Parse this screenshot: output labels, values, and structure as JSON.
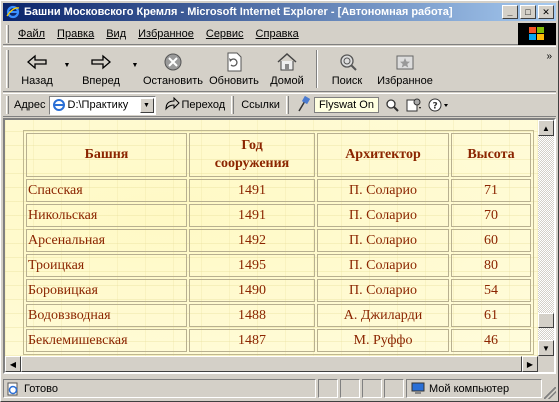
{
  "window": {
    "title": "Башни Московского Кремля - Microsoft Internet Explorer - [Автономная работа]",
    "buttons": [
      "minimize",
      "maximize",
      "close"
    ]
  },
  "menu": [
    {
      "label": "Файл"
    },
    {
      "label": "Правка"
    },
    {
      "label": "Вид"
    },
    {
      "label": "Избранное"
    },
    {
      "label": "Сервис"
    },
    {
      "label": "Справка"
    }
  ],
  "toolbar": {
    "back": "Назад",
    "forward": "Вперед",
    "stop": "Остановить",
    "refresh": "Обновить",
    "home": "Домой",
    "search": "Поиск",
    "favorites": "Избранное"
  },
  "addressbar": {
    "label": "Адрес",
    "value": "D:\\Практику",
    "go": "Переход",
    "links": "Ссылки",
    "flyswat": "Flyswat  On"
  },
  "table": {
    "headers": [
      "Башня",
      "Год сооружения",
      "Архитектор",
      "Высота"
    ],
    "rows": [
      [
        "Спасская",
        "1491",
        "П. Соларио",
        "71"
      ],
      [
        "Никольская",
        "1491",
        "П. Соларио",
        "70"
      ],
      [
        "Арсенальная",
        "1492",
        "П. Соларио",
        "60"
      ],
      [
        "Троицкая",
        "1495",
        "П. Соларио",
        "80"
      ],
      [
        "Боровицкая",
        "1490",
        "П. Соларио",
        "54"
      ],
      [
        "Водовзводная",
        "1488",
        "А. Джиларди",
        "61"
      ],
      [
        "Беклемишевская",
        "1487",
        "М. Руффо",
        "46"
      ]
    ]
  },
  "statusbar": {
    "status": "Готово",
    "zone": "Мой компьютер"
  },
  "colors": {
    "title_gradient_start": "#0a246a",
    "title_gradient_end": "#a6caf0",
    "table_text": "#8b2500",
    "page_background": "#fffde0"
  }
}
